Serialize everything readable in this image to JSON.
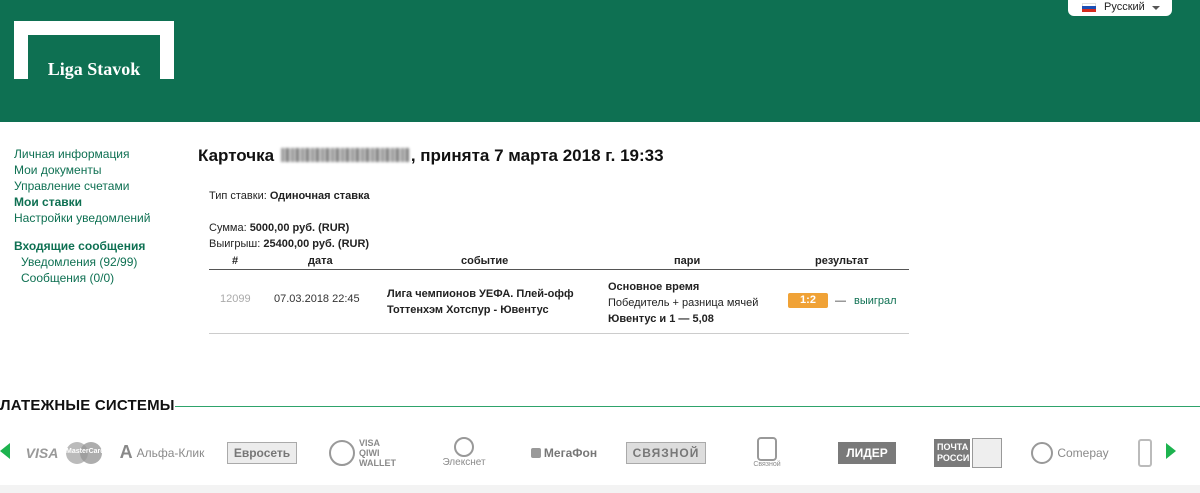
{
  "header": {
    "logo_text": "Liga Stavok",
    "language": "Русский"
  },
  "sidebar": {
    "items": [
      {
        "label": "Личная информация"
      },
      {
        "label": "Мои документы"
      },
      {
        "label": "Управление счетами"
      },
      {
        "label": "Мои ставки"
      },
      {
        "label": "Настройки уведомлений"
      }
    ],
    "messages_heading": "Входящие сообщения",
    "notifications": "Уведомления (92/99)",
    "messages": "Сообщения (0/0)"
  },
  "card": {
    "title_prefix": "Карточка",
    "title_suffix": ", принята 7 марта 2018 г. 19:33",
    "bet_type_label": "Тип ставки:",
    "bet_type_value": "Одиночная ставка",
    "sum_label": "Сумма:",
    "sum_value": "5000,00 руб. (RUR)",
    "win_label": "Выигрыш:",
    "win_value": "25400,00 руб. (RUR)"
  },
  "table": {
    "headers": [
      "#",
      "дата",
      "событие",
      "пари",
      "результат"
    ],
    "rows": [
      {
        "num": "12099",
        "date": "07.03.2018 22:45",
        "event_line1": "Лига чемпионов УЕФА. Плей-офф",
        "event_line2": "Тоттенхэм Хотспур - Ювентус",
        "bet_line1": "Основное время",
        "bet_line2": "Победитель + разница мячей",
        "bet_line3": "Ювентус и 1 — 5,08",
        "score": "1:2",
        "dash": "—",
        "result": "выиграл"
      }
    ]
  },
  "payments": {
    "title": "ЛАТЕЖНЫЕ СИСТЕМЫ",
    "logos": [
      "VISA",
      "MasterCard",
      "Альфа-Клик",
      "Евросеть",
      "VISA QIWI WALLET",
      "Элекснет",
      "МегаФон",
      "СВЯЗНОЙ",
      "Связной",
      "ЛИДЕР",
      "ПОЧТА РОССИИ",
      "Comepay"
    ]
  },
  "colors": {
    "brand": "#0e7052",
    "accent": "#f0a236",
    "arrow": "#1db34f"
  }
}
